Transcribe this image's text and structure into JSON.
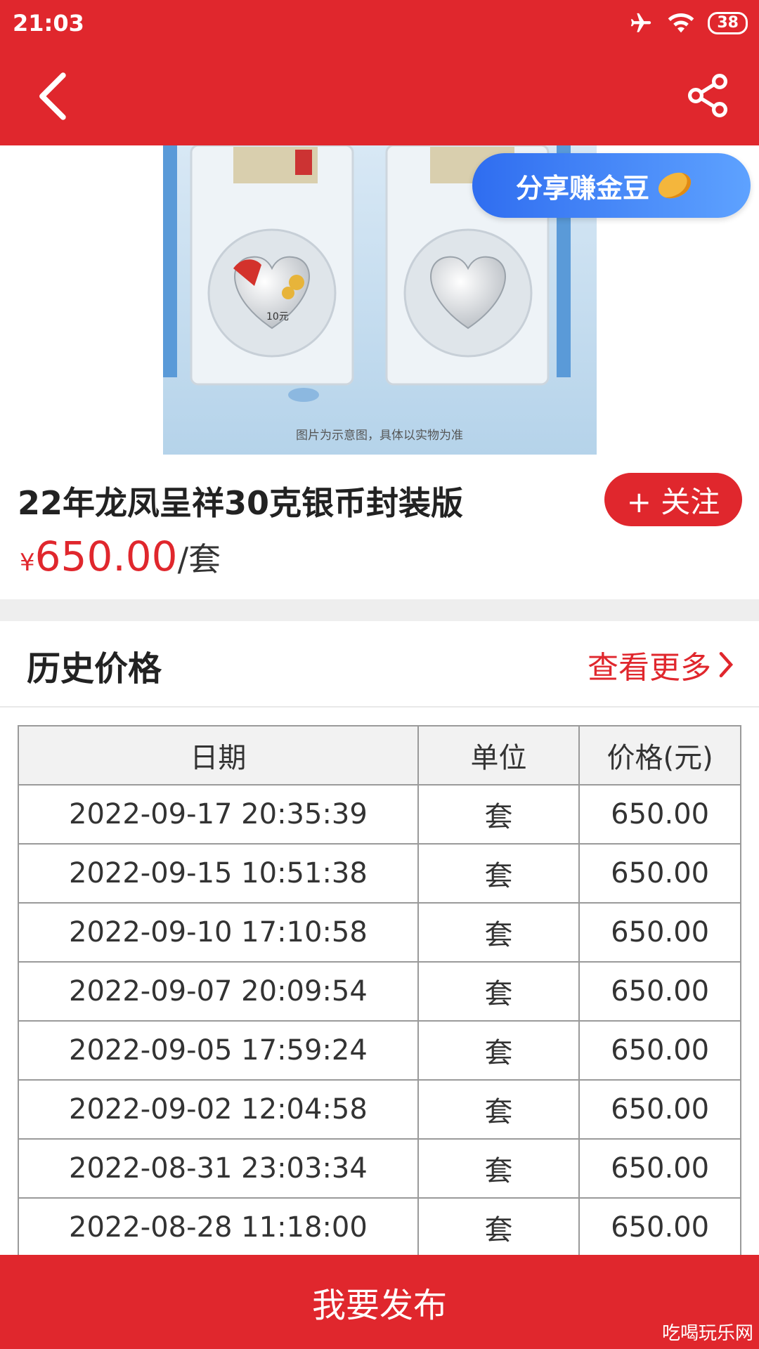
{
  "status_bar": {
    "time": "21:03",
    "battery": "38"
  },
  "product": {
    "image_caption": "图片为示意图，具体以实物为准",
    "coin_denomination": "10元",
    "title": "22年龙凤呈祥30克银币封装版",
    "price_symbol": "¥",
    "price": "650.00",
    "unit": "/套",
    "follow_label": "+ 关注"
  },
  "share_tip": {
    "label": "分享赚金豆"
  },
  "history": {
    "title": "历史价格",
    "more_label": "查看更多",
    "columns": [
      "日期",
      "单位",
      "价格(元)"
    ],
    "rows": [
      [
        "2022-09-17 20:35:39",
        "套",
        "650.00"
      ],
      [
        "2022-09-15 10:51:38",
        "套",
        "650.00"
      ],
      [
        "2022-09-10 17:10:58",
        "套",
        "650.00"
      ],
      [
        "2022-09-07 20:09:54",
        "套",
        "650.00"
      ],
      [
        "2022-09-05 17:59:24",
        "套",
        "650.00"
      ],
      [
        "2022-09-02 12:04:58",
        "套",
        "650.00"
      ],
      [
        "2022-08-31 23:03:34",
        "套",
        "650.00"
      ],
      [
        "2022-08-28 11:18:00",
        "套",
        "650.00"
      ]
    ]
  },
  "footer": {
    "publish_label": "我要发布"
  },
  "watermark": "吃喝玩乐网"
}
